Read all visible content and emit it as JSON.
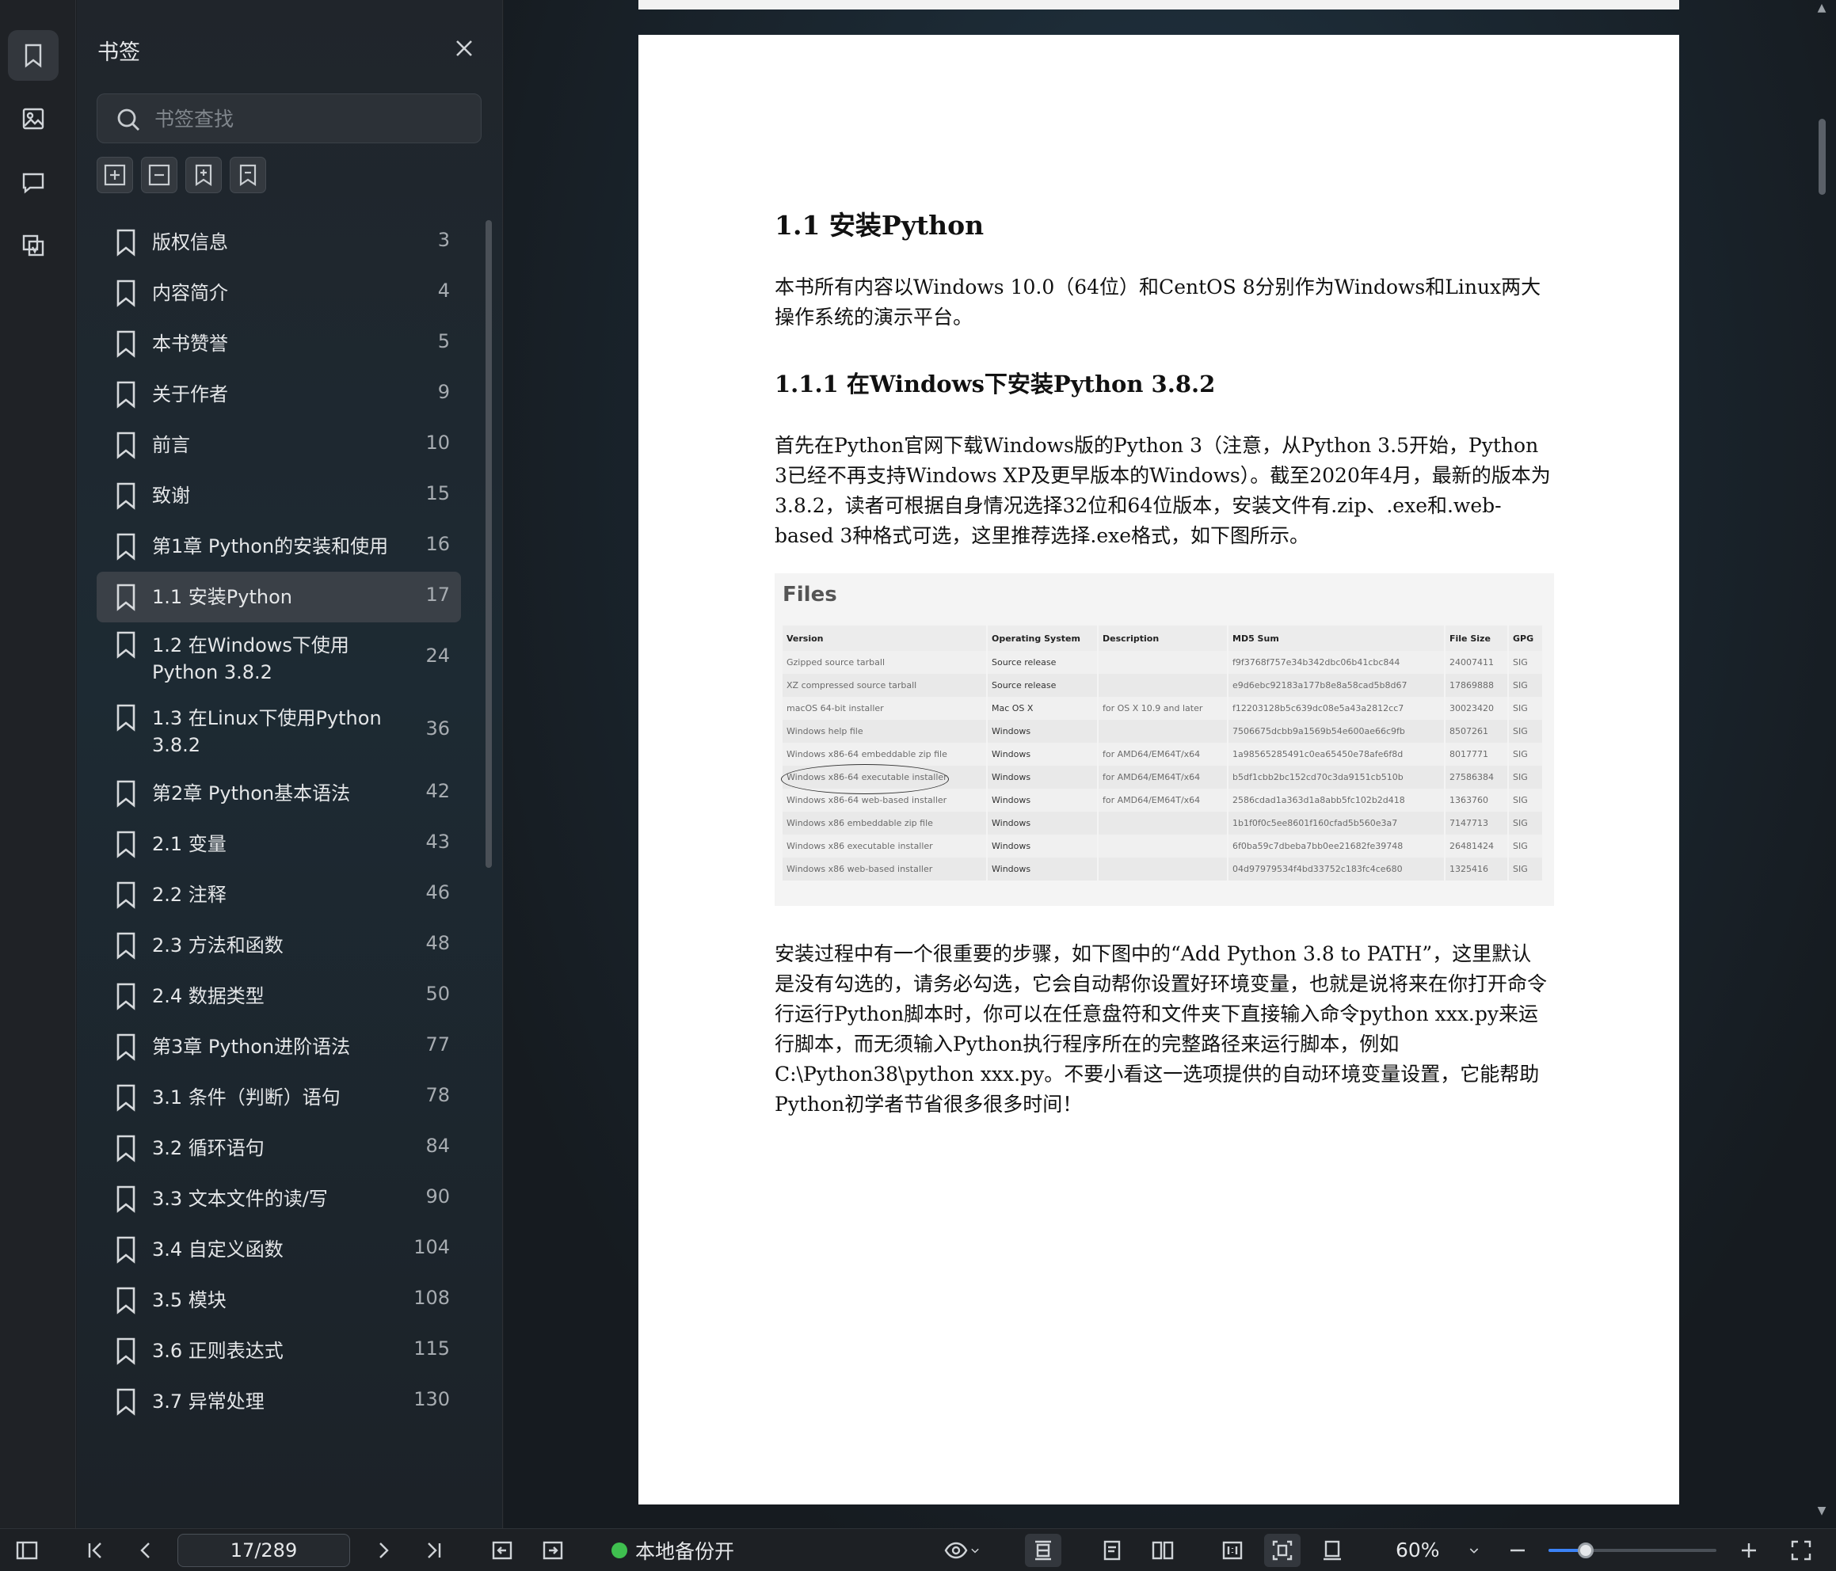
{
  "sidebar_rail": {
    "items": [
      {
        "name": "bookmark-icon",
        "active": true
      },
      {
        "name": "image-icon",
        "active": false
      },
      {
        "name": "comment-icon",
        "active": false
      },
      {
        "name": "page-thumbnail-icon",
        "active": false
      }
    ]
  },
  "bookmark_panel": {
    "title": "书签",
    "search_placeholder": "书签查找",
    "tools": [
      "expand-all-icon",
      "collapse-all-icon",
      "add-bookmark-icon",
      "remove-bookmark-icon"
    ],
    "items": [
      {
        "label": "版权信息",
        "page": "3"
      },
      {
        "label": "内容简介",
        "page": "4"
      },
      {
        "label": "本书赞誉",
        "page": "5"
      },
      {
        "label": "关于作者",
        "page": "9"
      },
      {
        "label": "前言",
        "page": "10"
      },
      {
        "label": "致谢",
        "page": "15"
      },
      {
        "label": "第1章 Python的安装和使用",
        "page": "16"
      },
      {
        "label": "1.1 安装Python",
        "page": "17",
        "active": true
      },
      {
        "label": "1.2 在Windows下使用Python 3.8.2",
        "page": "24"
      },
      {
        "label": "1.3 在Linux下使用Python 3.8.2",
        "page": "36"
      },
      {
        "label": "第2章 Python基本语法",
        "page": "42"
      },
      {
        "label": "2.1 变量",
        "page": "43"
      },
      {
        "label": "2.2 注释",
        "page": "46"
      },
      {
        "label": "2.3 方法和函数",
        "page": "48"
      },
      {
        "label": "2.4 数据类型",
        "page": "50"
      },
      {
        "label": "第3章 Python进阶语法",
        "page": "77"
      },
      {
        "label": "3.1 条件（判断）语句",
        "page": "78"
      },
      {
        "label": "3.2 循环语句",
        "page": "84"
      },
      {
        "label": "3.3 文本文件的读/写",
        "page": "90"
      },
      {
        "label": "3.4 自定义函数",
        "page": "104"
      },
      {
        "label": "3.5 模块",
        "page": "108"
      },
      {
        "label": "3.6 正则表达式",
        "page": "115"
      },
      {
        "label": "3.7 异常处理",
        "page": "130"
      }
    ]
  },
  "document": {
    "heading1": "1.1 安装Python",
    "para1": "本书所有内容以Windows 10.0（64位）和CentOS 8分别作为Windows和Linux两大操作系统的演示平台。",
    "heading2": "1.1.1 在Windows下安装Python 3.8.2",
    "para2": "首先在Python官网下载Windows版的Python 3（注意，从Python 3.5开始，Python 3已经不再支持Windows XP及更早版本的Windows）。截至2020年4月，最新的版本为3.8.2，读者可根据自身情况选择32位和64位版本，安装文件有.zip、.exe和.web-based 3种格式可选，这里推荐选择.exe格式，如下图所示。",
    "para3": "安装过程中有一个很重要的步骤，如下图中的“Add Python 3.8 to PATH”，这里默认是没有勾选的，请务必勾选，它会自动帮你设置好环境变量，也就是说将来在你打开命令行运行Python脚本时，你可以在任意盘符和文件夹下直接输入命令python xxx.py来运行脚本，而无须输入Python执行程序所在的完整路径来运行脚本，例如C:\\Python38\\python xxx.py。不要小看这一选项提供的自动环境变量设置，它能帮助Python初学者节省很多很多时间！",
    "files_figure": {
      "title": "Files",
      "columns": [
        "Version",
        "Operating System",
        "Description",
        "MD5 Sum",
        "File Size",
        "GPG"
      ],
      "rows": [
        [
          "Gzipped source tarball",
          "Source release",
          "",
          "f9f3768f757e34b342dbc06b41cbc844",
          "24007411",
          "SIG"
        ],
        [
          "XZ compressed source tarball",
          "Source release",
          "",
          "e9d6ebc92183a177b8e8a58cad5b8d67",
          "17869888",
          "SIG"
        ],
        [
          "macOS 64-bit installer",
          "Mac OS X",
          "for OS X 10.9 and later",
          "f12203128b5c639dc08e5a43a2812cc7",
          "30023420",
          "SIG"
        ],
        [
          "Windows help file",
          "Windows",
          "",
          "7506675dcbb9a1569b54e600ae66c9fb",
          "8507261",
          "SIG"
        ],
        [
          "Windows x86-64 embeddable zip file",
          "Windows",
          "for AMD64/EM64T/x64",
          "1a98565285491c0ea65450e78afe6f8d",
          "8017771",
          "SIG"
        ],
        [
          "Windows x86-64 executable installer",
          "Windows",
          "for AMD64/EM64T/x64",
          "b5df1cbb2bc152cd70c3da9151cb510b",
          "27586384",
          "SIG"
        ],
        [
          "Windows x86-64 web-based installer",
          "Windows",
          "for AMD64/EM64T/x64",
          "2586cdad1a363d1a8abb5fc102b2d418",
          "1363760",
          "SIG"
        ],
        [
          "Windows x86 embeddable zip file",
          "Windows",
          "",
          "1b1f0f0c5ee8601f160cfad5b560e3a7",
          "7147713",
          "SIG"
        ],
        [
          "Windows x86 executable installer",
          "Windows",
          "",
          "6f0ba59c7dbeba7bb0ee21682fe39748",
          "26481424",
          "SIG"
        ],
        [
          "Windows x86 web-based installer",
          "Windows",
          "",
          "04d97979534f4bd33752c183fc4ce680",
          "1325416",
          "SIG"
        ]
      ]
    }
  },
  "bottom_bar": {
    "page_indicator": "17/289",
    "backup_label": "本地备份开",
    "backup_status_color": "#3fbf4f",
    "zoom_label": "60%",
    "zoom_level": 0.22,
    "accent_color": "#3b82f6"
  }
}
